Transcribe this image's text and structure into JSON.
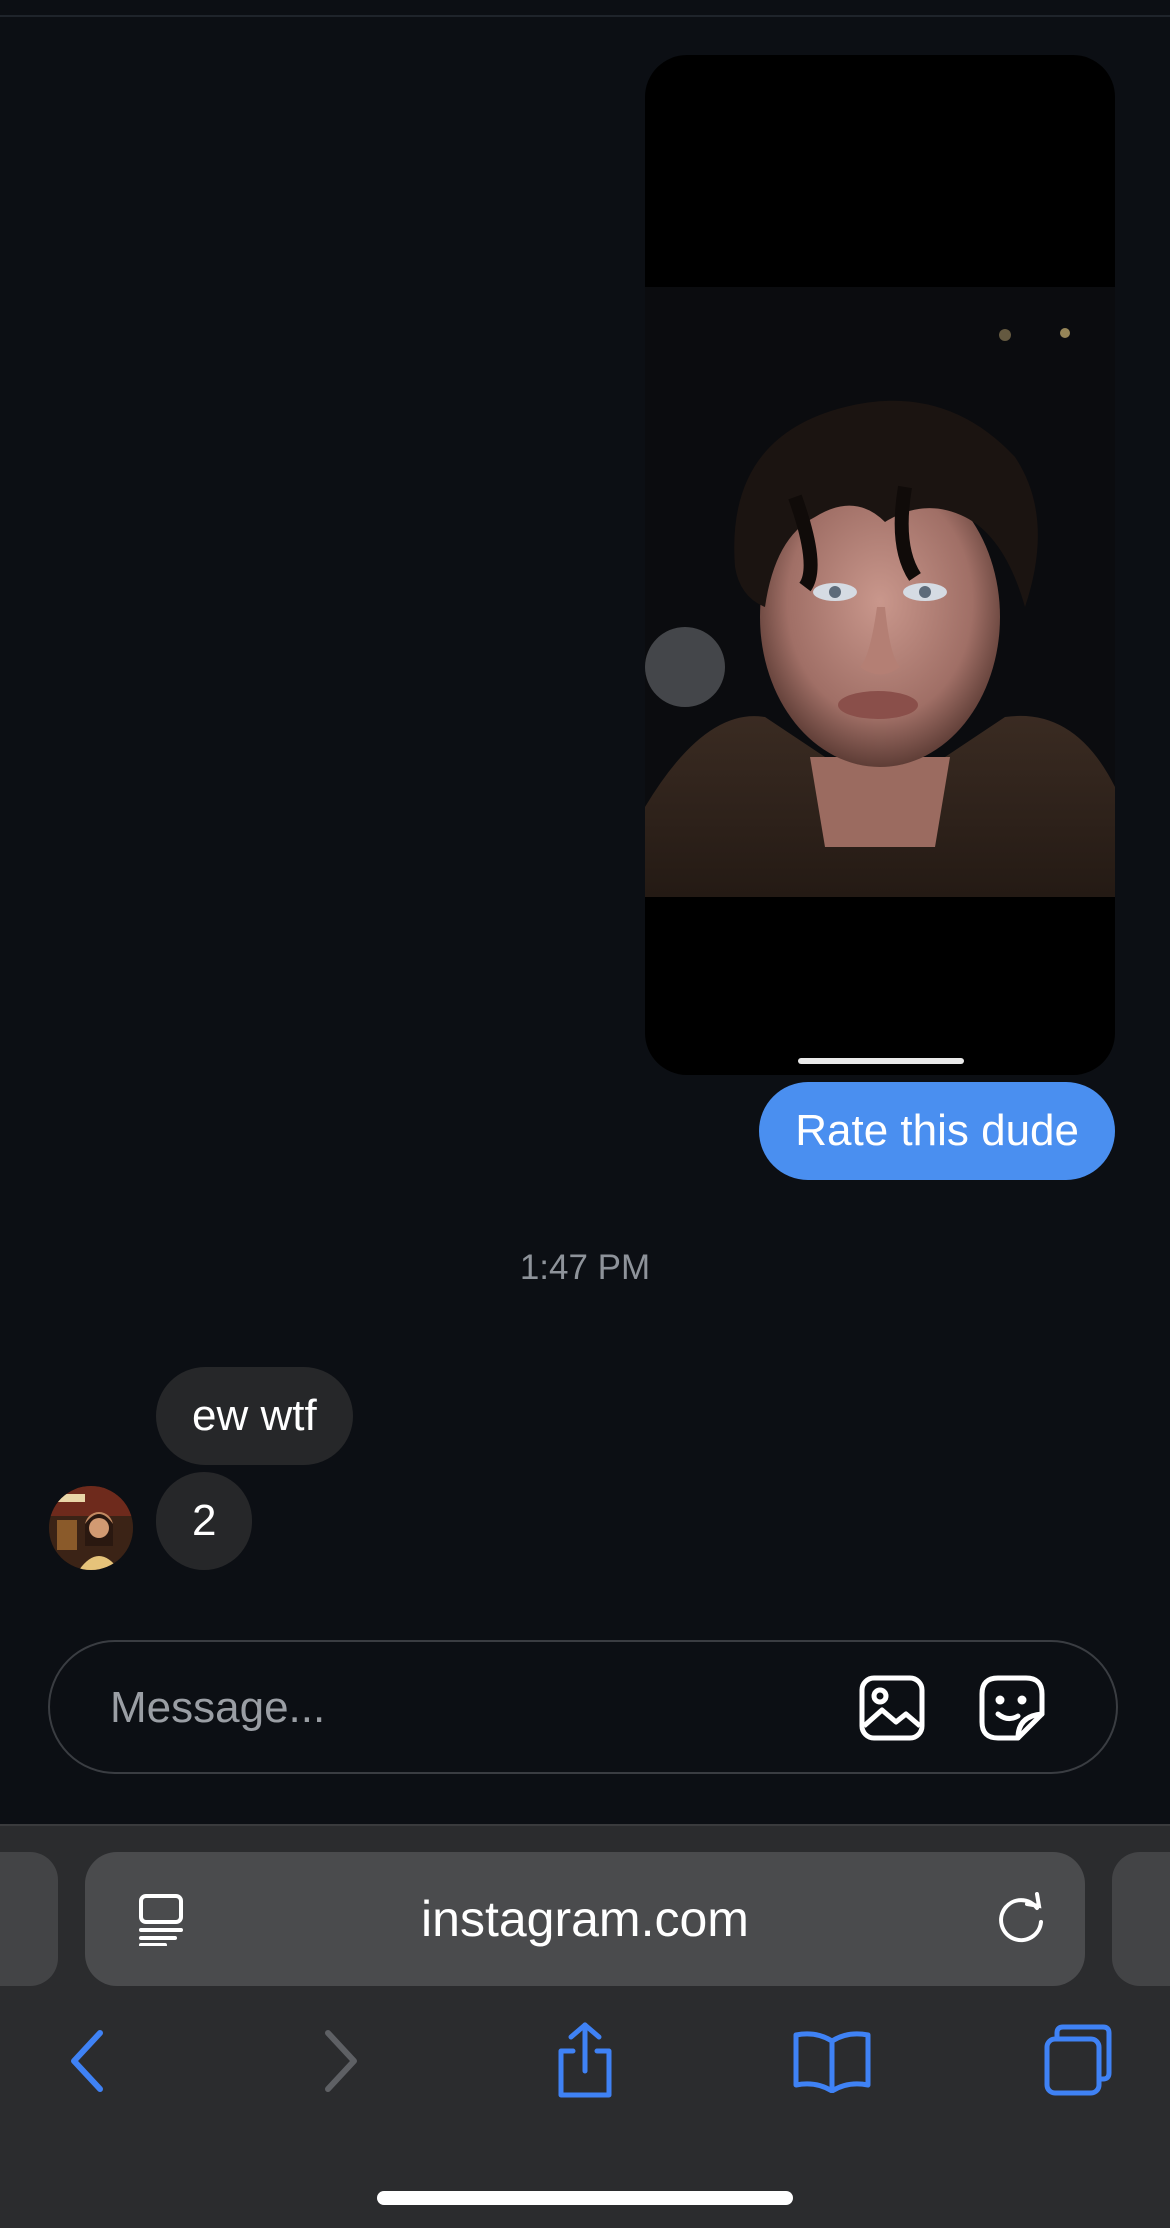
{
  "conversation": {
    "outgoing": [
      {
        "text": "Rate this dude"
      }
    ],
    "timestamp": "1:47 PM",
    "incoming": [
      {
        "text": "ew wtf"
      },
      {
        "text": "2"
      }
    ]
  },
  "composer": {
    "placeholder": "Message...",
    "icons": [
      "gallery-icon",
      "sticker-icon"
    ]
  },
  "browser": {
    "url": "instagram.com",
    "icons": [
      "reader-mode-icon",
      "reload-icon"
    ],
    "toolbar": [
      "back-icon",
      "forward-icon",
      "share-icon",
      "bookmarks-icon",
      "tabs-icon"
    ]
  },
  "colors": {
    "background": "#0c0f14",
    "outgoing_bubble": "#4a8ff0",
    "incoming_bubble": "#262729",
    "accent": "#3f82f5"
  }
}
